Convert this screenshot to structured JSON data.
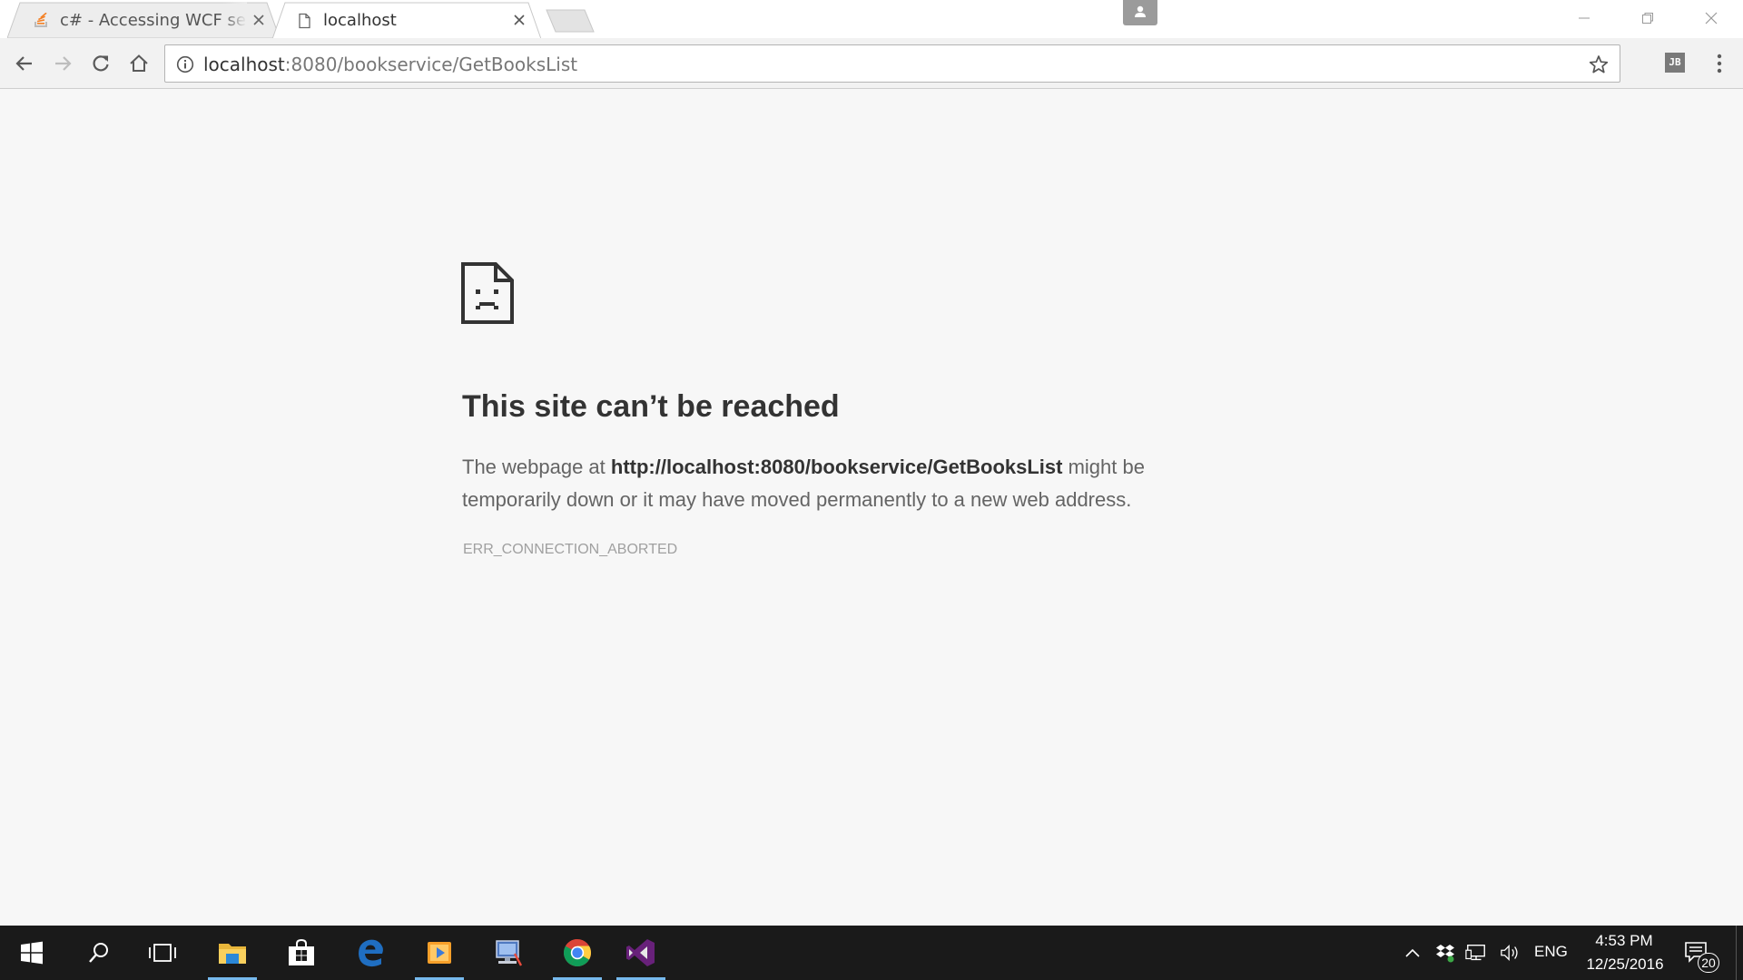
{
  "browser": {
    "tabs": [
      {
        "title": "c# - Accessing WCF serv",
        "favicon": "stackoverflow-icon",
        "active": false
      },
      {
        "title": "localhost",
        "favicon": "page-icon",
        "active": true
      }
    ],
    "address": {
      "host": "localhost",
      "path": ":8080/bookservice/GetBooksList"
    }
  },
  "error": {
    "title": "This site can’t be reached",
    "desc_prefix": "The webpage at ",
    "desc_url": "http://localhost:8080/bookservice/GetBooksList",
    "desc_suffix": " might be temporarily down or it may have moved permanently to a new web address.",
    "code": "ERR_CONNECTION_ABORTED"
  },
  "extensions": {
    "jb_label": "JB"
  },
  "taskbar": {
    "apps": [
      "start",
      "search",
      "task-view",
      "file-explorer",
      "store",
      "edge",
      "media-player",
      "network-tool",
      "chrome",
      "visual-studio"
    ],
    "tray": {
      "language": "ENG",
      "time": "4:53 PM",
      "date": "12/25/2016",
      "notification_count": "20"
    }
  },
  "colors": {
    "content_bg": "#f7f7f7",
    "taskbar_bg": "#1a1a1a",
    "active_indicator": "#76b9ed",
    "vs_purple": "#68217a",
    "edge_blue": "#1f6ec1"
  }
}
